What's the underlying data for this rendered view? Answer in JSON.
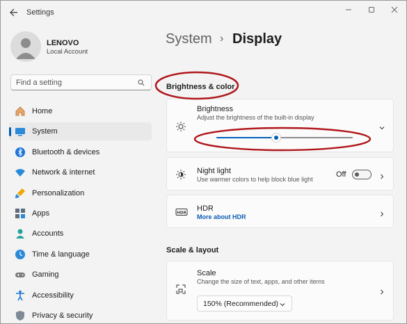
{
  "window": {
    "title": "Settings"
  },
  "account": {
    "name": "LENOVO",
    "type": "Local Account"
  },
  "search": {
    "placeholder": "Find a setting"
  },
  "sidebar": {
    "items": [
      {
        "label": "Home",
        "icon": "home-icon"
      },
      {
        "label": "System",
        "icon": "system-icon",
        "active": true
      },
      {
        "label": "Bluetooth & devices",
        "icon": "bluetooth-icon"
      },
      {
        "label": "Network & internet",
        "icon": "network-icon"
      },
      {
        "label": "Personalization",
        "icon": "brush-icon"
      },
      {
        "label": "Apps",
        "icon": "apps-icon"
      },
      {
        "label": "Accounts",
        "icon": "accounts-icon"
      },
      {
        "label": "Time & language",
        "icon": "clock-icon"
      },
      {
        "label": "Gaming",
        "icon": "gamepad-icon"
      },
      {
        "label": "Accessibility",
        "icon": "accessibility-icon"
      },
      {
        "label": "Privacy & security",
        "icon": "shield-icon"
      }
    ]
  },
  "breadcrumb": {
    "parent": "System",
    "separator": "›",
    "current": "Display"
  },
  "sections": {
    "brightness_color": "Brightness & color",
    "scale_layout": "Scale & layout"
  },
  "brightness": {
    "title": "Brightness",
    "subtitle": "Adjust the brightness of the built-in display",
    "level_percent": 44
  },
  "night_light": {
    "title": "Night light",
    "subtitle": "Use warmer colors to help block blue light",
    "state": "Off"
  },
  "hdr": {
    "title": "HDR",
    "link": "More about HDR",
    "icon_text": "HDR"
  },
  "scale": {
    "title": "Scale",
    "subtitle": "Change the size of text, apps, and other items",
    "selected": "150% (Recommended)"
  },
  "colors": {
    "accent": "#005fb8",
    "annotation": "#b0161b"
  }
}
